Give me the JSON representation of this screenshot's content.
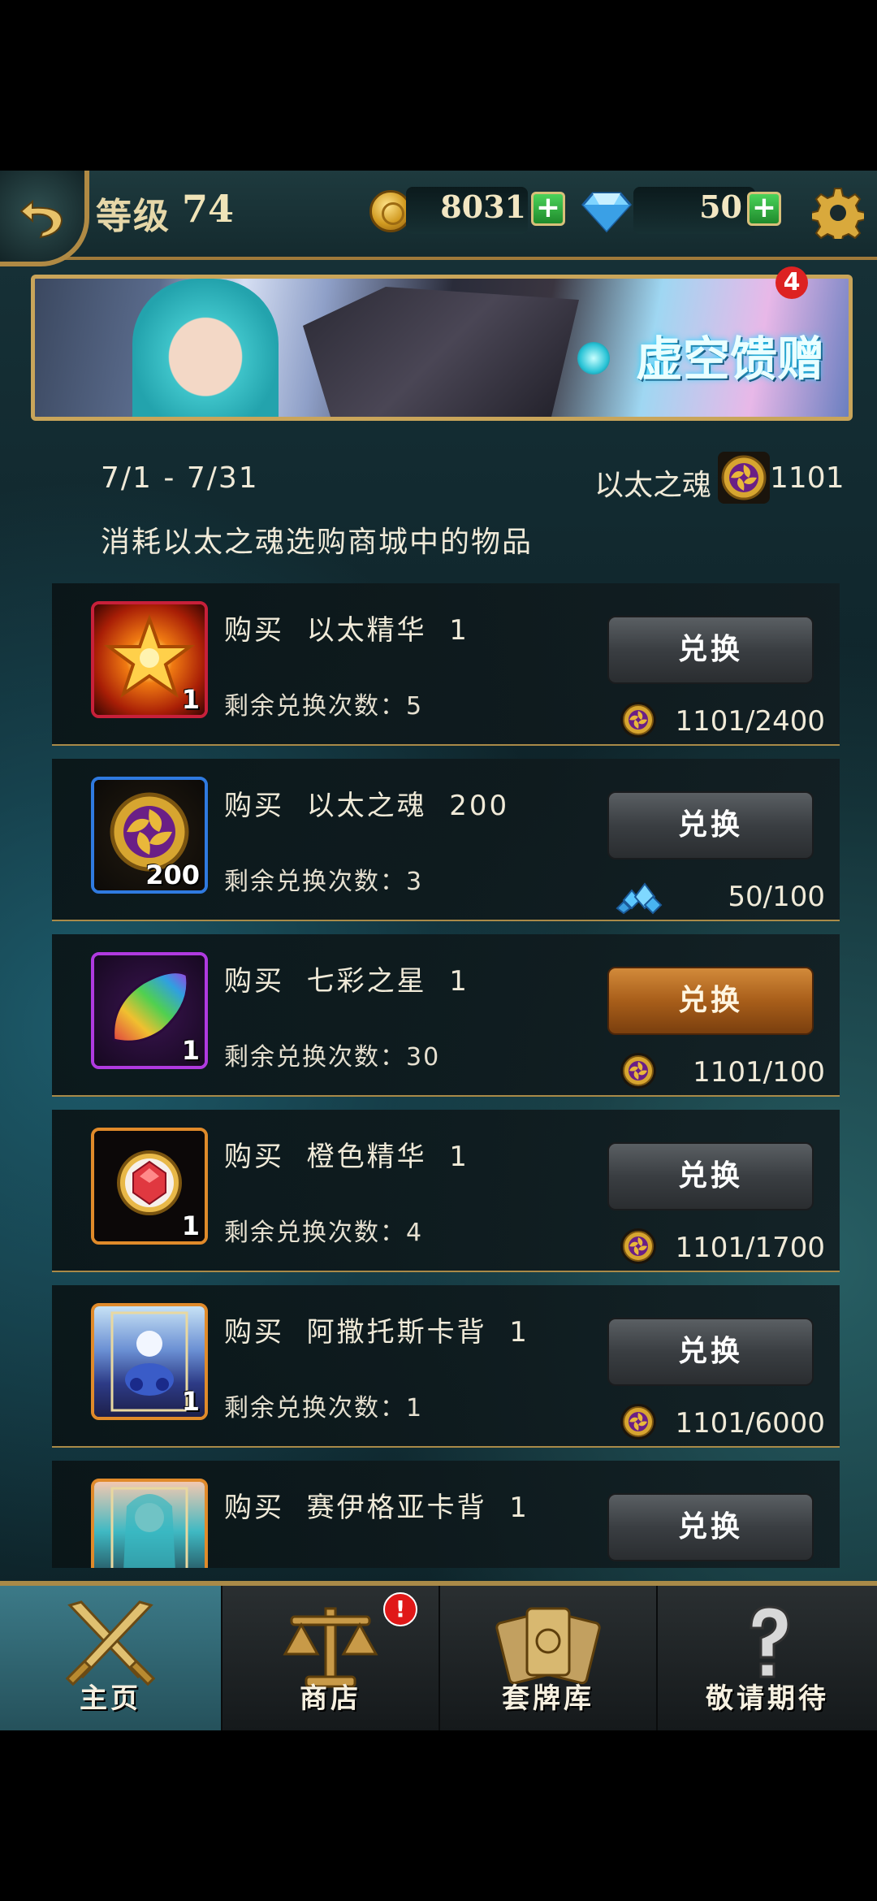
{
  "topbar": {
    "level_label": "等级",
    "level_value": "74",
    "gold": "8031",
    "diamonds": "50",
    "plus": "+"
  },
  "banner": {
    "title": "虚空馈赠",
    "badge": "4"
  },
  "info": {
    "date_range": "7/1 - 7/31",
    "currency_label": "以太之魂",
    "currency_count": "1101",
    "description": "消耗以太之魂选购商城中的物品"
  },
  "items": [
    {
      "name": "购买  以太精华  1",
      "qty": "1",
      "remaining": "剩余兑换次数：5",
      "button": "兑换",
      "cost": "1101/2400",
      "cost_icon": "ether-soul-icon"
    },
    {
      "name": "购买  以太之魂  200",
      "qty": "200",
      "remaining": "剩余兑换次数：3",
      "button": "兑换",
      "cost": "50/100",
      "cost_icon": "diamond-pile-icon"
    },
    {
      "name": "购买  七彩之星  1",
      "qty": "1",
      "remaining": "剩余兑换次数：30",
      "button": "兑换",
      "cost": "1101/100",
      "cost_icon": "ether-soul-icon"
    },
    {
      "name": "购买  橙色精华  1",
      "qty": "1",
      "remaining": "剩余兑换次数：4",
      "button": "兑换",
      "cost": "1101/1700",
      "cost_icon": "ether-soul-icon"
    },
    {
      "name": "购买  阿撒托斯卡背  1",
      "qty": "1",
      "remaining": "剩余兑换次数：1",
      "button": "兑换",
      "cost": "1101/6000",
      "cost_icon": "ether-soul-icon"
    },
    {
      "name": "购买  赛伊格亚卡背  1",
      "button": "兑换"
    }
  ],
  "nav": [
    {
      "label": "主页",
      "icon": "crossed-swords-icon",
      "active": true
    },
    {
      "label": "商店",
      "icon": "scales-icon",
      "badge": "!"
    },
    {
      "label": "套牌库",
      "icon": "card-deck-icon"
    },
    {
      "label": "敬请期待",
      "icon": "question-mark-icon"
    }
  ],
  "colors": {
    "accent_gold": "#a98a48",
    "active_button": "#c07a2a",
    "nav_active": "#3c7a88"
  }
}
